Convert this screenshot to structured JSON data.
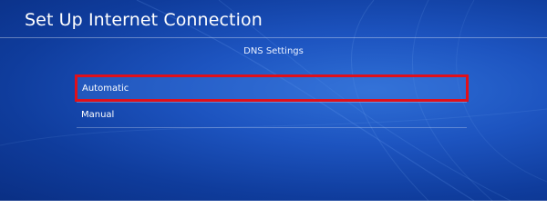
{
  "header": {
    "title": "Set Up Internet Connection"
  },
  "section": {
    "heading": "DNS Settings"
  },
  "options": [
    {
      "label": "Automatic",
      "selected": true
    },
    {
      "label": "Manual",
      "selected": false
    }
  ],
  "colors": {
    "background": "#1d54c0",
    "highlight_border": "#e0101a",
    "text": "#ffffff"
  }
}
